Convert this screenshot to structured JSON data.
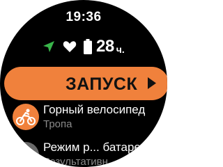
{
  "status": {
    "time": "19:36",
    "battery_hours": "28",
    "battery_unit": "ч.",
    "icons": [
      "gps-arrow-icon",
      "heart-icon",
      "battery-icon"
    ],
    "gps_color": "#39b54a"
  },
  "start_button": {
    "label": "ЗАПУСК",
    "icon": "play-icon",
    "color": "#f0813c"
  },
  "list": [
    {
      "title": "Горный велосипед",
      "subtitle": "Тропа",
      "icon": "mountain-bike-icon"
    },
    {
      "title": "Режим р... батаре",
      "subtitle": "Результативн",
      "icon": "battery-mode-icon"
    }
  ]
}
